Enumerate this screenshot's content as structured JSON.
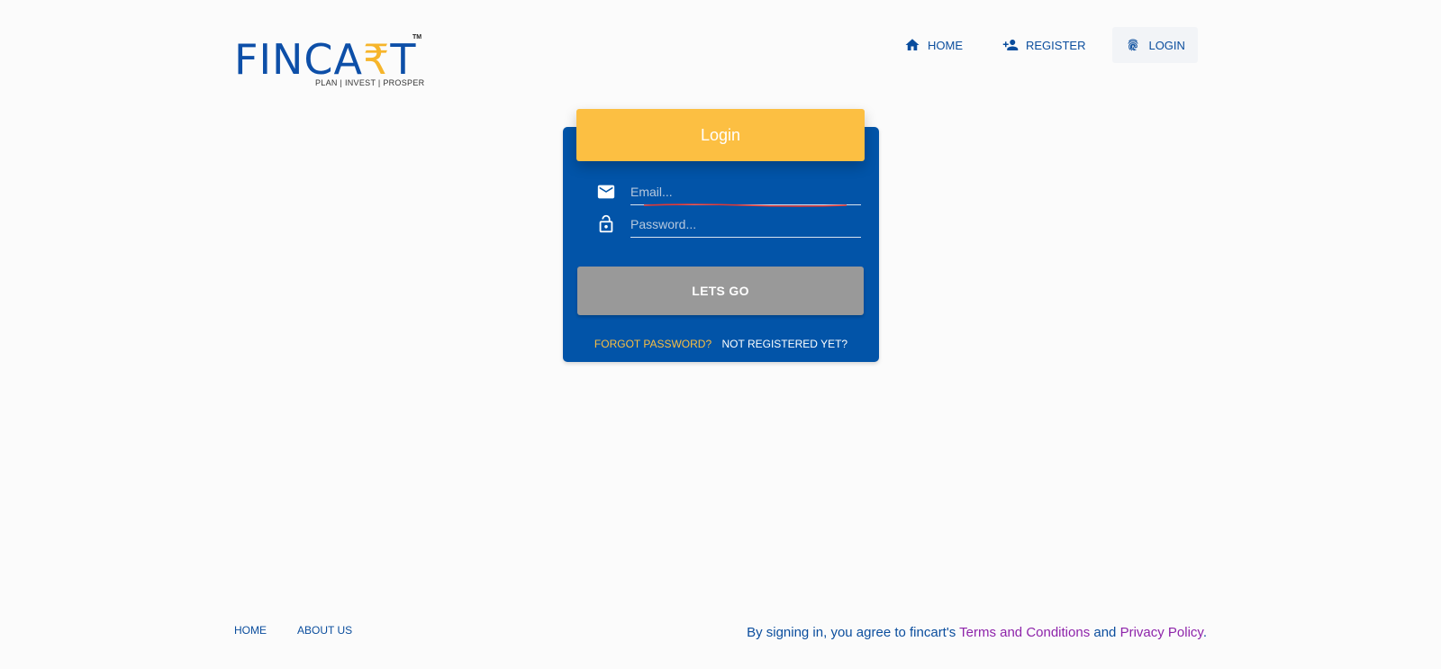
{
  "brand": {
    "name_prefix": "FINCA",
    "name_rupee": "₹",
    "name_suffix": "T",
    "trademark": "TM",
    "tagline": "PLAN | INVEST | PROSPER",
    "primary_color": "#0254a8",
    "accent_color": "#fcbf42"
  },
  "nav": {
    "items": [
      {
        "label": "HOME",
        "icon": "home-icon"
      },
      {
        "label": "REGISTER",
        "icon": "person-add-icon"
      },
      {
        "label": "LOGIN",
        "icon": "fingerprint-icon",
        "active": true
      }
    ]
  },
  "login": {
    "title": "Login",
    "email_placeholder": "Email...",
    "email_value": "",
    "password_placeholder": "Password...",
    "password_value": "",
    "submit_label": "LETS GO",
    "forgot_label": "FORGOT PASSWORD?",
    "register_label": "NOT REGISTERED YET?",
    "email_icon": "email-icon",
    "password_icon": "lock-icon"
  },
  "footer": {
    "links": [
      "HOME",
      "ABOUT US"
    ],
    "legal_prefix": "By signing in, you agree to fincart's ",
    "terms_label": "Terms and Conditions",
    "legal_middle": " and ",
    "privacy_label": "Privacy Policy",
    "legal_suffix": ".",
    "link_color": "#8e24aa"
  }
}
